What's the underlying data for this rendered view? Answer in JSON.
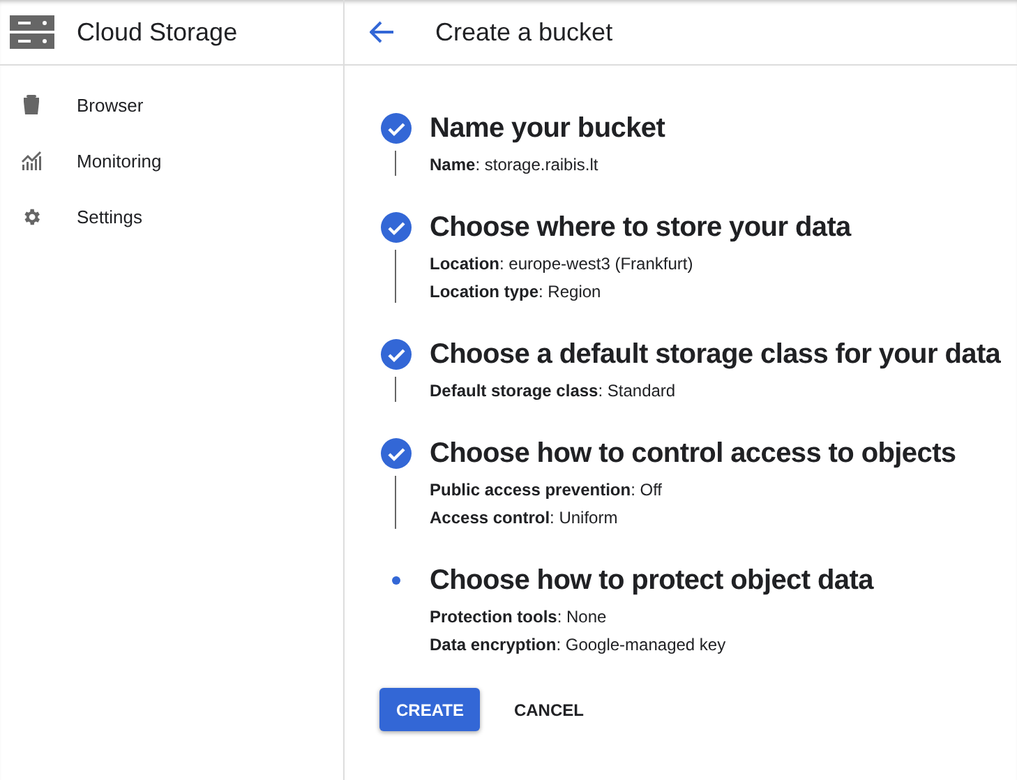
{
  "sidebar": {
    "title": "Cloud Storage",
    "items": [
      {
        "label": "Browser",
        "kind": "bucket"
      },
      {
        "label": "Monitoring",
        "kind": "chart"
      },
      {
        "label": "Settings",
        "kind": "gear"
      }
    ]
  },
  "header": {
    "title": "Create a bucket"
  },
  "steps": [
    {
      "title": "Name your bucket",
      "done": true,
      "details": [
        "**Name**: storage.raibis.lt"
      ]
    },
    {
      "title": "Choose where to store your data",
      "done": true,
      "details": [
        "**Location**: europe-west3 (Frankfurt)",
        "**Location type**: Region"
      ]
    },
    {
      "title": "Choose a default storage class for your data",
      "done": true,
      "details": [
        "**Default storage class**: Standard"
      ]
    },
    {
      "title": "Choose how to control access to objects",
      "done": true,
      "details": [
        "**Public access prevention**: Off",
        "**Access control**: Uniform"
      ]
    },
    {
      "title": "Choose how to protect object data",
      "done": false,
      "details": [
        "**Protection tools**: None",
        "**Data encryption**: Google-managed key"
      ]
    }
  ],
  "buttons": [
    {
      "label": "CREATE",
      "kind": "primary"
    },
    {
      "label": "CANCEL",
      "kind": "text"
    }
  ]
}
